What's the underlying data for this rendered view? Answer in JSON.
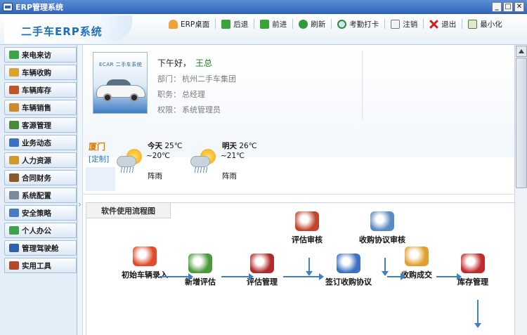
{
  "window": {
    "title": "ERP管理系统",
    "controls": [
      "_",
      "□",
      "✕"
    ]
  },
  "header": {
    "logo_text": "二手车ERP系统"
  },
  "toolbar": [
    {
      "label": "ERP桌面",
      "icon": "home-icon",
      "cls": "ic-home"
    },
    {
      "label": "后退",
      "icon": "back-icon",
      "cls": "ic-back"
    },
    {
      "label": "前进",
      "icon": "forward-icon",
      "cls": "ic-fwd"
    },
    {
      "label": "刷新",
      "icon": "refresh-icon",
      "cls": "ic-refresh"
    },
    {
      "label": "考勤打卡",
      "icon": "clock-icon",
      "cls": "ic-clock"
    },
    {
      "label": "注销",
      "icon": "logout-icon",
      "cls": "ic-logout"
    },
    {
      "label": "退出",
      "icon": "exit-icon",
      "cls": "ic-exit"
    },
    {
      "label": "最小化",
      "icon": "minimize-icon",
      "cls": "ic-min"
    }
  ],
  "sidebar": {
    "items": [
      {
        "label": "来电来访",
        "color": "#3fa34d"
      },
      {
        "label": "车辆收购",
        "color": "#e0a12c"
      },
      {
        "label": "车辆库存",
        "color": "#c0552a"
      },
      {
        "label": "车辆销售",
        "color": "#d08a2a"
      },
      {
        "label": "客源管理",
        "color": "#4a8a3a"
      },
      {
        "label": "业务动态",
        "color": "#3b73c2"
      },
      {
        "label": "人力资源",
        "color": "#d09a2a"
      },
      {
        "label": "合同财务",
        "color": "#8a5a2a"
      },
      {
        "label": "系统配置",
        "color": "#7a8a9a"
      },
      {
        "label": "安全策略",
        "color": "#4a7ac2"
      },
      {
        "label": "个人办公",
        "color": "#3fa34d"
      },
      {
        "label": "管理驾驶舱",
        "color": "#2a62b0"
      },
      {
        "label": "实用工具",
        "color": "#b04a2a"
      }
    ]
  },
  "profile": {
    "card_text": "ECAR 二手车系统",
    "greeting": "下午好，",
    "user_name": "王总",
    "department_label": "部门：",
    "department": "杭州二手车集团",
    "position_label": "职务：",
    "position": "总经理",
    "role_label": "权限：",
    "role": "系统管理员"
  },
  "weather": {
    "city": "厦门",
    "custom_link": "[定制]",
    "today": {
      "day": "今天",
      "high": "25℃",
      "low": "~20℃",
      "condition": "阵雨"
    },
    "tomorrow": {
      "day": "明天",
      "high": "26℃",
      "low": "~21℃",
      "condition": "阵雨"
    }
  },
  "flow": {
    "tab_label": "软件使用流程图",
    "nodes": [
      {
        "label": "初始车辆录入",
        "icon": "red-car-icon",
        "color": "#e04a2a"
      },
      {
        "label": "新增评估",
        "icon": "book-icon",
        "color": "#4a9a3a"
      },
      {
        "label": "评估管理",
        "icon": "red-book-icon",
        "color": "#b02a2a"
      },
      {
        "label": "评估审核",
        "icon": "box-icon",
        "color": "#c0452a"
      },
      {
        "label": "签订收购协议",
        "icon": "grid-icon",
        "color": "#3b73c2"
      },
      {
        "label": "收购协议审核",
        "icon": "magnifier-icon",
        "color": "#5a8ac2"
      },
      {
        "label": "收购成交",
        "icon": "cars-gift-icon",
        "color": "#e0a12c"
      },
      {
        "label": "库存管理",
        "icon": "cars-icon",
        "color": "#c02a2a"
      }
    ]
  }
}
